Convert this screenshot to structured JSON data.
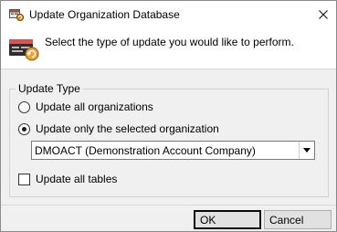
{
  "window": {
    "title": "Update Organization Database",
    "title_icon": "database-update-icon",
    "close_icon": "close-icon"
  },
  "header": {
    "icon": "database-refresh-icon",
    "prompt": "Select the type of update you would like to perform."
  },
  "update_type": {
    "legend": "Update Type",
    "options": [
      {
        "label": "Update all organizations",
        "selected": false
      },
      {
        "label": "Update only the selected organization",
        "selected": true
      }
    ],
    "organization_select": {
      "value": "DMOACT (Demonstration Account Company)",
      "arrow_icon": "dropdown-arrow-icon"
    },
    "update_all_tables": {
      "label": "Update all tables",
      "checked": false
    }
  },
  "buttons": {
    "ok_label": "OK",
    "cancel_label": "Cancel"
  }
}
